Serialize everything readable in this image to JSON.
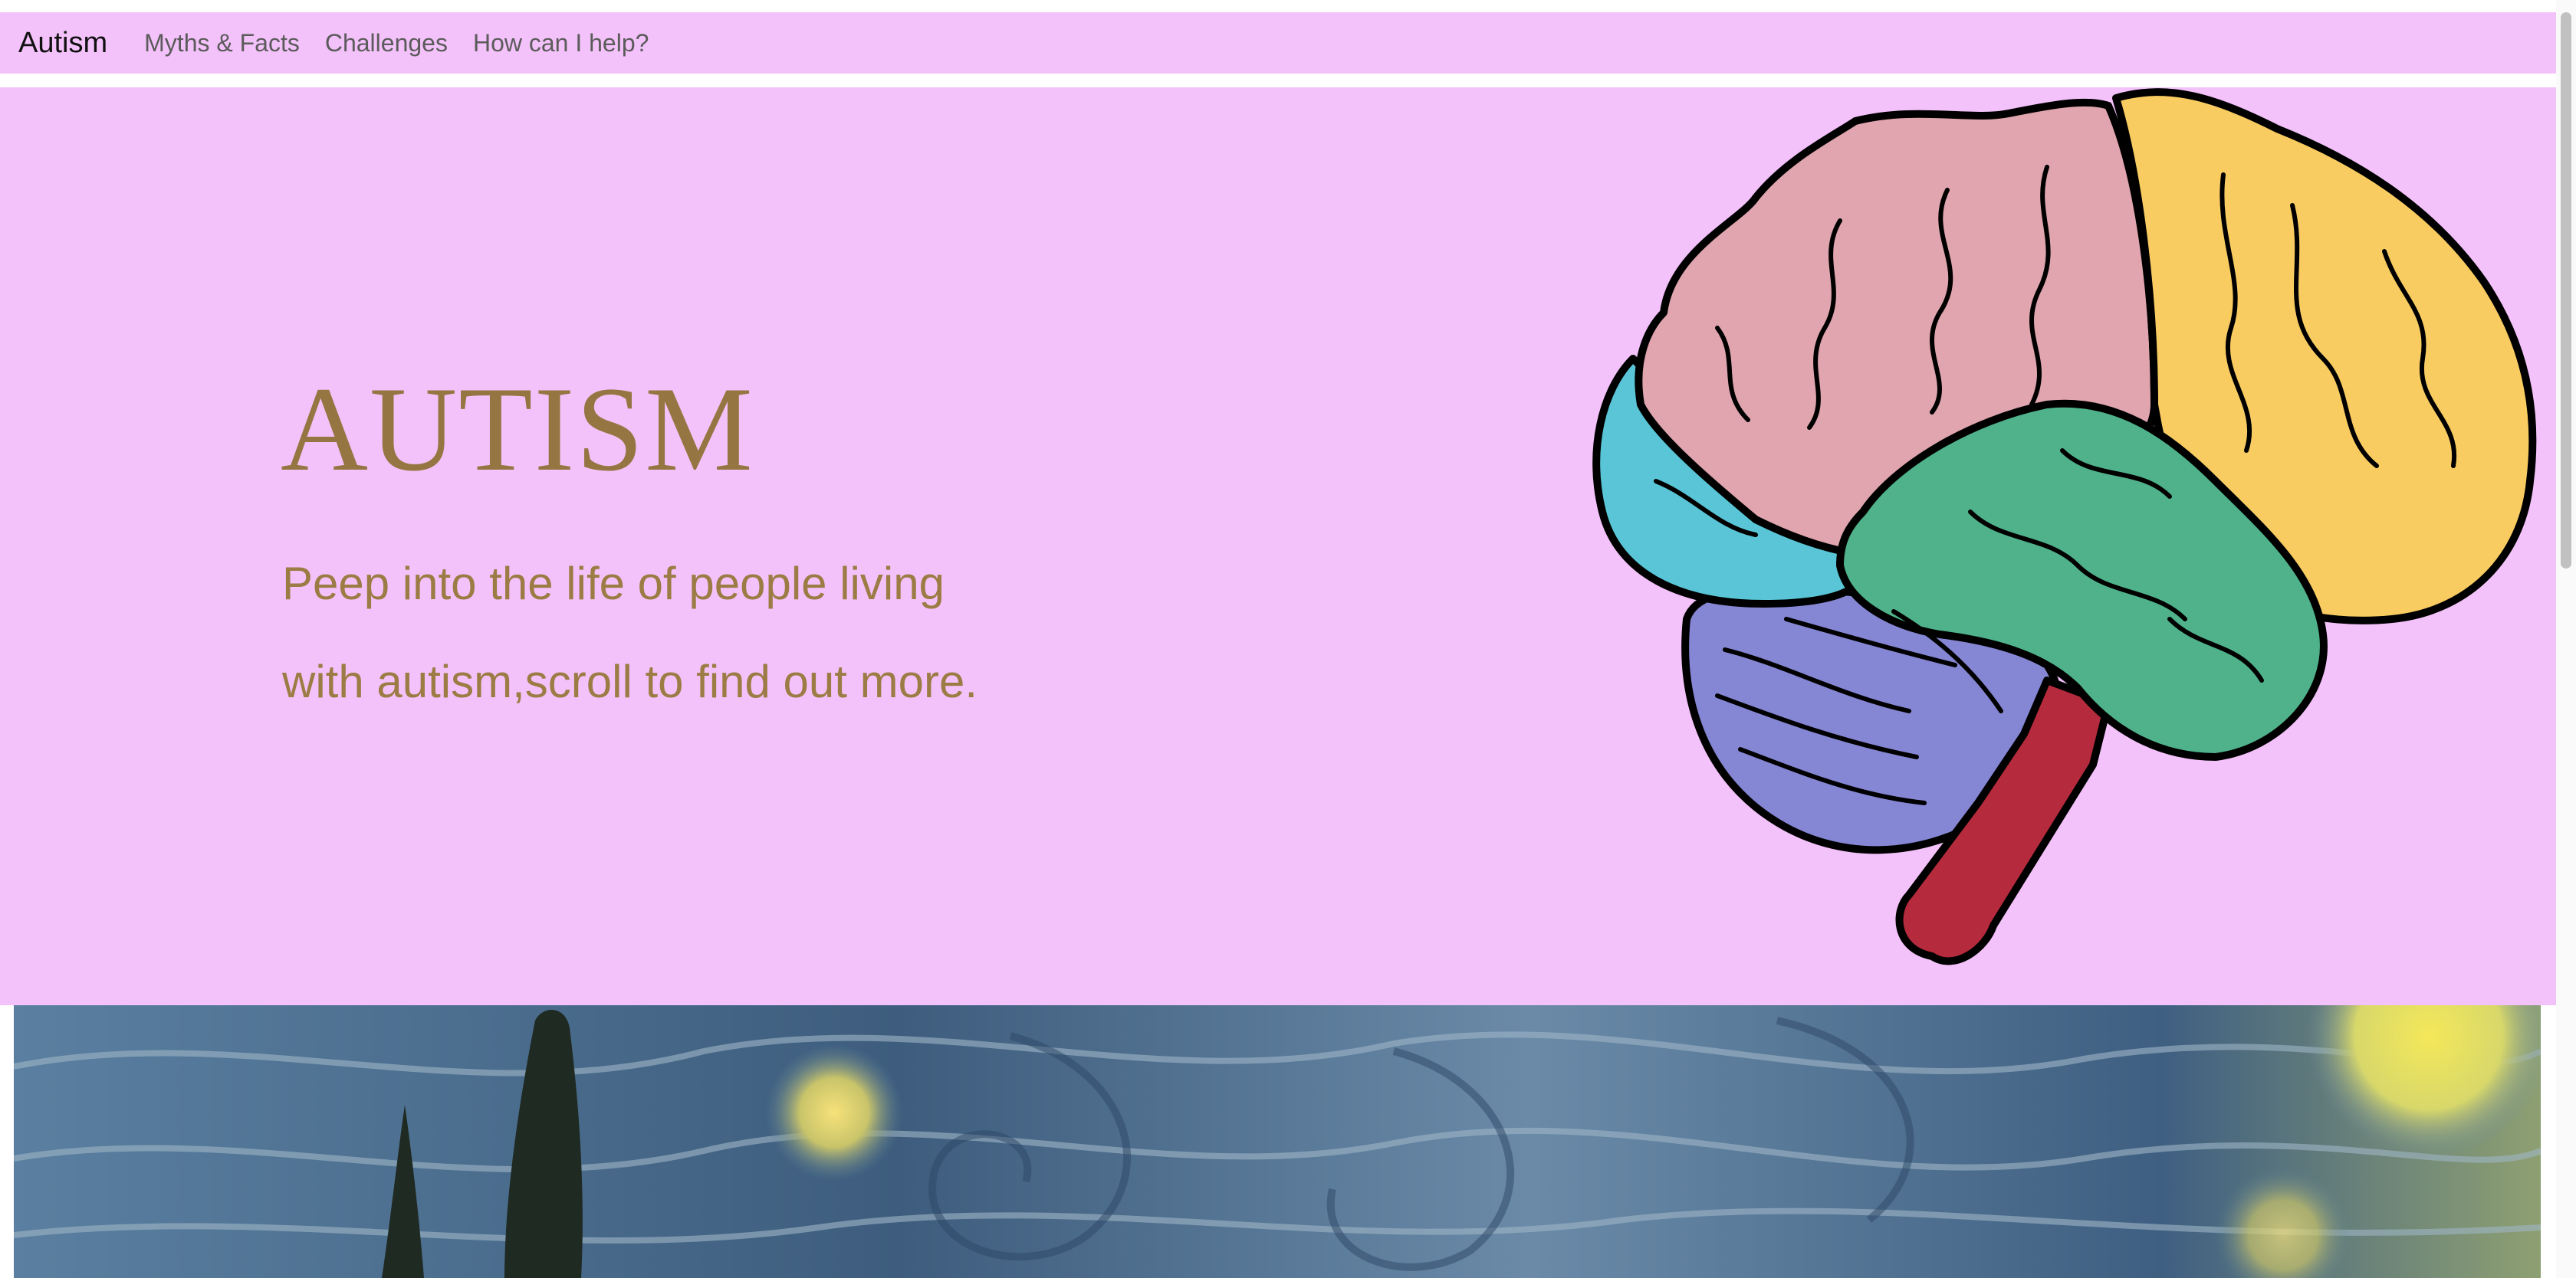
{
  "navbar": {
    "brand": "Autism",
    "links": [
      {
        "label": "Myths & Facts"
      },
      {
        "label": "Challenges"
      },
      {
        "label": "How can I help?"
      }
    ]
  },
  "hero": {
    "title": "AUTISM",
    "subtitle_line1": "Peep into the life of people living",
    "subtitle_line2": "with autism,scroll to find out more."
  },
  "images": {
    "brain": "brain-illustration",
    "painting": "starry-night-painting"
  },
  "colors": {
    "background_pink": "#f4c2fa",
    "heading_gold": "#957643",
    "brain_pink": "#e0a5ae",
    "brain_yellow": "#f9cc62",
    "brain_green": "#4fb28b",
    "brain_cyan": "#59c5d6",
    "brain_purple": "#8586d4",
    "brain_red": "#b52b3d"
  }
}
